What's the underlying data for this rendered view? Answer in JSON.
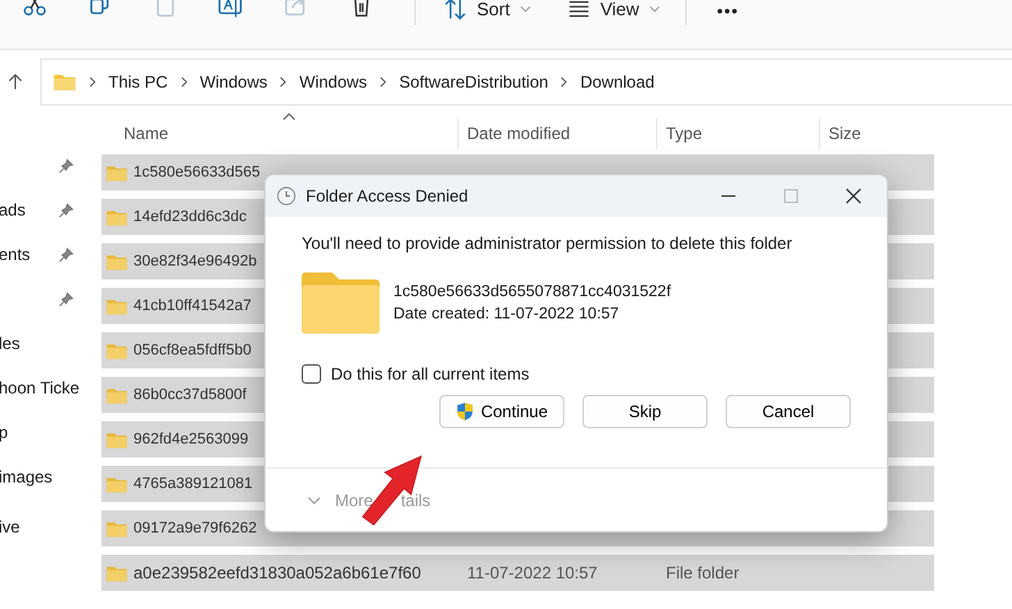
{
  "toolbar": {
    "sort": "Sort",
    "view": "View",
    "more": "•••"
  },
  "address": {
    "crumbs": [
      "This PC",
      "Windows",
      "Windows",
      "SoftwareDistribution",
      "Download"
    ]
  },
  "columns": [
    "Name",
    "Date modified",
    "Type",
    "Size"
  ],
  "sidebar": {
    "items": [
      {
        "pinned": true
      },
      {
        "label": "ads",
        "pinned": true
      },
      {
        "label": "ents",
        "pinned": true
      },
      {
        "pinned": true
      },
      {
        "label": "les",
        "pinned": false
      },
      {
        "label": "hoon Ticke",
        "pinned": false
      },
      {
        "label": "p",
        "pinned": false
      },
      {
        "label": "images",
        "pinned": false
      },
      {
        "label": "ive",
        "pinned": false
      }
    ]
  },
  "rows": [
    {
      "name": "1c580e56633d565"
    },
    {
      "name": "14efd23dd6c3dc"
    },
    {
      "name": "30e82f34e96492b"
    },
    {
      "name": "41cb10ff41542a7"
    },
    {
      "name": "056cf8ea5fdff5b0"
    },
    {
      "name": "86b0cc37d5800f"
    },
    {
      "name": "962fd4e2563099"
    },
    {
      "name": "4765a389121081"
    },
    {
      "name": "09172a9e79f6262"
    },
    {
      "name": "a0e239582eefd31830a052a6b61e7f60",
      "date": "11-07-2022 10:57",
      "type": "File folder"
    }
  ],
  "dialog": {
    "title": "Folder Access Denied",
    "message": "You'll need to provide administrator permission to delete this folder",
    "folder_name": "1c580e56633d5655078871cc4031522f",
    "date_created": "Date created: 11-07-2022 10:57",
    "checkbox": {
      "label": "Do this for all current items",
      "checked": false
    },
    "buttons": [
      {
        "label": "Continue",
        "kind": "shield"
      },
      {
        "label": "Skip",
        "kind": "plain"
      },
      {
        "label": "Cancel",
        "kind": "plain"
      }
    ],
    "details": [
      "More",
      "tails"
    ]
  }
}
